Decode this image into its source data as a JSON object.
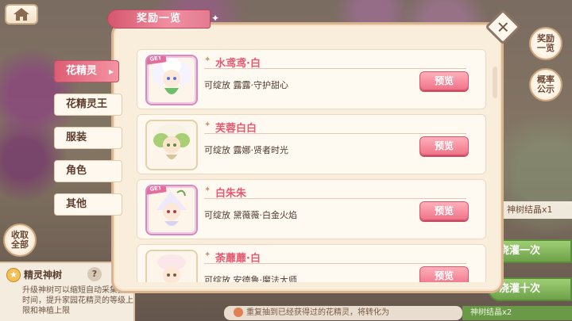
{
  "topbar": {
    "home_icon": "house-icon"
  },
  "dialog": {
    "title": "奖励一览",
    "close_icon": "close-x-icon"
  },
  "categories": [
    {
      "label": "花精灵",
      "active": true
    },
    {
      "label": "花精灵王",
      "active": false
    },
    {
      "label": "服装",
      "active": false
    },
    {
      "label": "角色",
      "active": false
    },
    {
      "label": "其他",
      "active": false
    }
  ],
  "rewards": [
    {
      "name": "水鸢鸢·白",
      "desc": "可绽放 露露·守护甜心",
      "preview": "预览",
      "get": true,
      "get_label": "GET"
    },
    {
      "name": "芙蓉白白",
      "desc": "可绽放 露娜·贤者时光",
      "preview": "预览",
      "get": false
    },
    {
      "name": "白朱朱",
      "desc": "可绽放 黛薇薇·白金火焰",
      "preview": "预览",
      "get": true,
      "get_label": "GET"
    },
    {
      "name": "荼蘼蘼·白",
      "desc": "可绽放 安德鲁·魔法大师",
      "preview": "预览",
      "get": false
    }
  ],
  "side_buttons": {
    "rewards": "奖励一览",
    "probability": "概率公示"
  },
  "collect_all": "收取全部",
  "tree_panel": {
    "title": "精灵神树",
    "help": "?",
    "desc": "升级神树可以缩短自动采集晶的时间，提升家园花精灵的等级上限和神植上限"
  },
  "right_panel": {
    "crystal": "神树结晶x1",
    "irrigate_once": "浇灌一次",
    "irrigate_ten": "浇灌十次",
    "crystal_cost": "神树结晶x2"
  },
  "bottom_note": "重复抽到已经获得过的花精灵，将转化为"
}
